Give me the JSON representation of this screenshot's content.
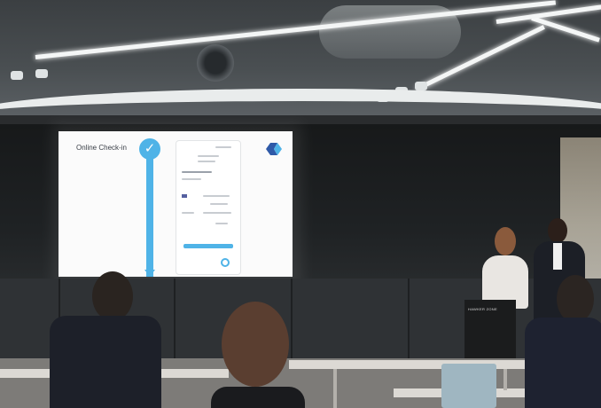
{
  "slide": {
    "title": "Online Check-in",
    "check_icon": "checkmark-icon",
    "arrow_icon": "arrow-down-icon",
    "logo_icon": "brand-logo-icon",
    "accent_color": "#4fb3e7"
  },
  "podium": {
    "label": "HAWKER ZONE"
  }
}
